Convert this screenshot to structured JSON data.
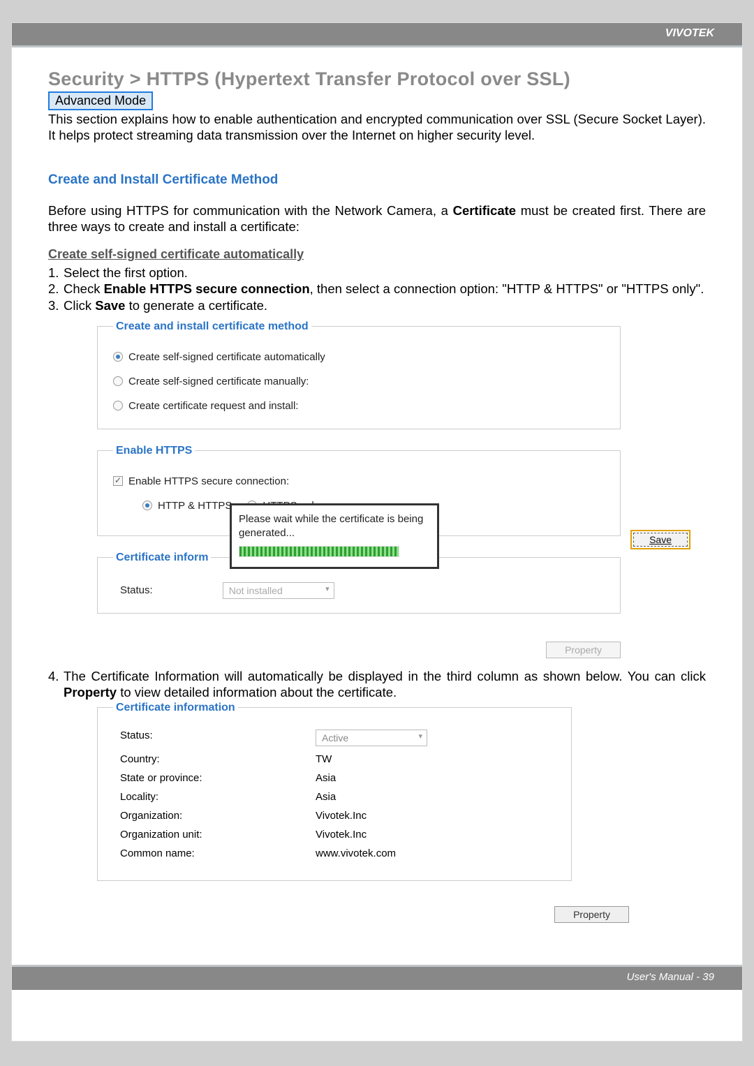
{
  "brand": "VIVOTEK",
  "title": "Security >  HTTPS (Hypertext Transfer Protocol over SSL)",
  "adv_mode": "Advanced Mode",
  "intro": "This section explains how to enable authentication and encrypted communication over SSL (Secure Socket Layer). It helps protect streaming data transmission over the Internet on higher security level.",
  "section1": "Create and Install Certificate Method",
  "before": {
    "pre": "Before using HTTPS for communication with the Network Camera, a ",
    "bold": "Certificate",
    "post": " must be created first. There are three ways to create and install a certificate:"
  },
  "subhead": "Create self-signed certificate automatically",
  "step1": "Select the first option.",
  "step2": {
    "pre": "Check ",
    "bold": "Enable HTTPS secure connection",
    "post": ", then select a connection option: \"HTTP & HTTPS\" or \"HTTPS only\"."
  },
  "step3": {
    "pre": "Click ",
    "bold": "Save",
    "post": " to generate a certificate."
  },
  "panel": {
    "fs1_legend": "Create and install certificate method",
    "opt1": "Create self-signed certificate automatically",
    "opt2": "Create self-signed certificate manually:",
    "opt3": "Create certificate request and install:",
    "fs2_legend": "Enable HTTPS",
    "chk_label": "Enable HTTPS secure connection:",
    "mode1": "HTTP & HTTPS",
    "mode2": "HTTPS only",
    "fs3_legend": "Certificate inform",
    "status_label": "Status:",
    "status_value": "Not installed",
    "save": "Save",
    "popup_msg": "Please wait while the certificate is being generated...",
    "property": "Property"
  },
  "step4": {
    "pre": "The Certificate Information will automatically be displayed in the third column as shown below. You can click ",
    "bold": "Property",
    "post": " to view detailed information about the certificate."
  },
  "cert_info": {
    "legend": "Certificate information",
    "rows": [
      {
        "k": "Status:",
        "v": "Active",
        "dropdown": true
      },
      {
        "k": "Country:",
        "v": "TW"
      },
      {
        "k": "State or province:",
        "v": "Asia"
      },
      {
        "k": "Locality:",
        "v": "Asia"
      },
      {
        "k": "Organization:",
        "v": "Vivotek.Inc"
      },
      {
        "k": "Organization unit:",
        "v": "Vivotek.Inc"
      },
      {
        "k": "Common name:",
        "v": "www.vivotek.com"
      }
    ],
    "property": "Property"
  },
  "footer": "User's Manual - 39"
}
